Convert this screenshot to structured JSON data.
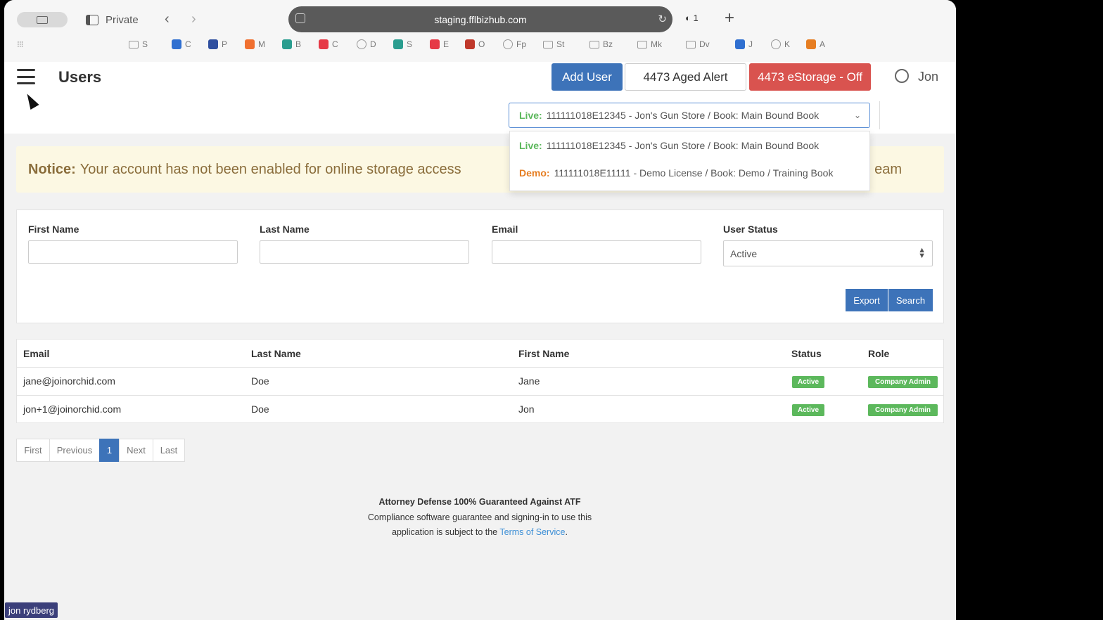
{
  "browser": {
    "private_label": "Private",
    "url": "staging.fflbizhub.com",
    "extension_count": "1",
    "bookmarks": [
      {
        "label": "S",
        "icon": "folder-icon",
        "color": "#999999"
      },
      {
        "label": "C",
        "icon": "app-icon",
        "color": "#2f6fd0"
      },
      {
        "label": "P",
        "icon": "app-icon",
        "color": "#2f4f9f"
      },
      {
        "label": "M",
        "icon": "app-icon",
        "color": "#f07030"
      },
      {
        "label": "B",
        "icon": "app-icon",
        "color": "#2a9d8f"
      },
      {
        "label": "C",
        "icon": "app-icon",
        "color": "#e63946"
      },
      {
        "label": "D",
        "icon": "globe-icon",
        "color": "#999999"
      },
      {
        "label": "S",
        "icon": "app-icon",
        "color": "#2a9d8f"
      },
      {
        "label": "E",
        "icon": "app-icon",
        "color": "#e63946"
      },
      {
        "label": "O",
        "icon": "app-icon",
        "color": "#c0392b"
      },
      {
        "label": "Fp",
        "icon": "globe-icon",
        "color": "#999999"
      },
      {
        "label": "St",
        "icon": "folder-icon",
        "color": "#999999"
      },
      {
        "label": "Bz",
        "icon": "folder-icon",
        "color": "#999999"
      },
      {
        "label": "Mk",
        "icon": "folder-icon",
        "color": "#999999"
      },
      {
        "label": "Dv",
        "icon": "folder-icon",
        "color": "#999999"
      },
      {
        "label": "J",
        "icon": "app-icon",
        "color": "#2f6fd0"
      },
      {
        "label": "K",
        "icon": "globe-icon",
        "color": "#999999"
      },
      {
        "label": "A",
        "icon": "app-icon",
        "color": "#e67e22"
      }
    ]
  },
  "header": {
    "title": "Users",
    "add_user": "Add User",
    "aged_alert": "4473 Aged Alert",
    "estorage": "4473 eStorage - Off",
    "user_name": "Jon"
  },
  "license": {
    "selected_tag": "Live:",
    "selected_text": "111111018E12345 - Jon's Gun Store / Book: Main Bound Book",
    "options": [
      {
        "tag": "Live:",
        "text": "111111018E12345 - Jon's Gun Store / Book: Main Bound Book"
      },
      {
        "tag": "Demo:",
        "text": "111111018E11111 - Demo License / Book: Demo / Training Book"
      }
    ]
  },
  "notice": {
    "label": "Notice:",
    "text": "Your account has not been enabled for online storage access",
    "tail": "eam"
  },
  "filters": {
    "first_name_label": "First Name",
    "last_name_label": "Last Name",
    "email_label": "Email",
    "status_label": "User Status",
    "status_value": "Active",
    "export": "Export",
    "search": "Search"
  },
  "table": {
    "headers": {
      "email": "Email",
      "last_name": "Last Name",
      "first_name": "First Name",
      "status": "Status",
      "role": "Role"
    },
    "rows": [
      {
        "email": "jane@joinorchid.com",
        "last_name": "Doe",
        "first_name": "Jane",
        "status": "Active",
        "role": "Company Admin"
      },
      {
        "email": "jon+1@joinorchid.com",
        "last_name": "Doe",
        "first_name": "Jon",
        "status": "Active",
        "role": "Company Admin"
      }
    ]
  },
  "pagination": {
    "first": "First",
    "previous": "Previous",
    "current": "1",
    "next": "Next",
    "last": "Last"
  },
  "footer": {
    "title": "Attorney Defense 100% Guaranteed Against ATF",
    "line1": "Compliance software guarantee and signing-in to use this",
    "line2_prefix": "application is subject to the",
    "tos": "Terms of Service",
    "line2_suffix": "."
  },
  "overlay_name": "jon rydberg"
}
